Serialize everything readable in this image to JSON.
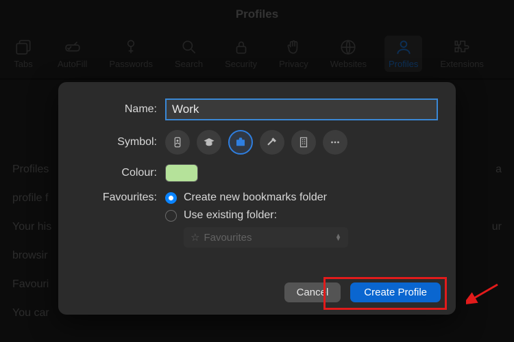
{
  "window": {
    "title": "Profiles"
  },
  "toolbar": {
    "items": [
      {
        "label": "Tabs"
      },
      {
        "label": "AutoFill"
      },
      {
        "label": "Passwords"
      },
      {
        "label": "Search"
      },
      {
        "label": "Security"
      },
      {
        "label": "Privacy"
      },
      {
        "label": "Websites"
      },
      {
        "label": "Profiles"
      },
      {
        "label": "Extensions"
      }
    ]
  },
  "background": {
    "p1_a": "Profiles",
    "p1_b": "a",
    "p2_start": "profile f",
    "p3_a": "Your his",
    "p3_b": "ur",
    "p4_a": "browsir",
    "p5_a": "Favouri",
    "p6_a": "You car"
  },
  "sheet": {
    "labels": {
      "name": "Name:",
      "symbol": "Symbol:",
      "colour": "Colour:",
      "favourites": "Favourites:"
    },
    "name_value": "Work",
    "symbols": [
      {
        "id": "id-card"
      },
      {
        "id": "graduation"
      },
      {
        "id": "briefcase",
        "selected": true
      },
      {
        "id": "hammer"
      },
      {
        "id": "building"
      },
      {
        "id": "more"
      }
    ],
    "colour": "#b5e29a",
    "fav_options": {
      "create_label": "Create new bookmarks folder",
      "existing_label": "Use existing folder:",
      "selected": "create"
    },
    "folder_select": {
      "value": "Favourites"
    },
    "buttons": {
      "cancel": "Cancel",
      "create": "Create Profile"
    }
  }
}
